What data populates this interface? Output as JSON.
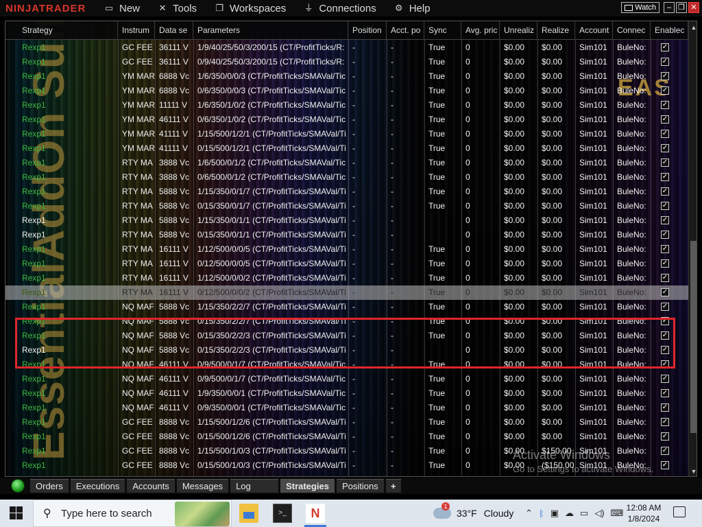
{
  "app": {
    "logo": "NINJATRADER",
    "menu": [
      {
        "label": "New",
        "icon": "new-window-icon"
      },
      {
        "label": "Tools",
        "icon": "tools-icon"
      },
      {
        "label": "Workspaces",
        "icon": "workspaces-icon"
      },
      {
        "label": "Connections",
        "icon": "plug-icon"
      },
      {
        "label": "Help",
        "icon": "help-icon"
      }
    ],
    "watch_label": "Watch"
  },
  "grid": {
    "watermark": "EssentialAddOn Suite",
    "eas_logo": "EAS",
    "columns": [
      "Strategy",
      "Instrum",
      "Data se",
      "Parameters",
      "Position",
      "Acct. po",
      "Sync",
      "Avg. pric",
      "Unrealiz",
      "Realize",
      "Account",
      "Connec",
      "Enablec"
    ],
    "rows": [
      {
        "strategy": "Rexp1",
        "instrument": "GC FEE",
        "data": "36111 V",
        "params": "1/9/40/25/50/3/200/15 (CT/ProfitTicks/R:",
        "position": "-",
        "acct": "-",
        "sync": "True",
        "avg": "0",
        "unreal": "$0.00",
        "real": "$0.00",
        "account": "Sim101",
        "conn": "BuleNo:",
        "white": false
      },
      {
        "strategy": "Rexp1",
        "instrument": "GC FEE",
        "data": "36111 V",
        "params": "0/9/40/25/50/3/200/15 (CT/ProfitTicks/R:",
        "position": "-",
        "acct": "-",
        "sync": "True",
        "avg": "0",
        "unreal": "$0.00",
        "real": "$0.00",
        "account": "Sim101",
        "conn": "BuleNo:",
        "white": false
      },
      {
        "strategy": "Rexp1",
        "instrument": "YM MAR",
        "data": "6888 Vc",
        "params": "1/6/350/0/0/3 (CT/ProfitTicks/SMAVal/Tic",
        "position": "-",
        "acct": "-",
        "sync": "True",
        "avg": "0",
        "unreal": "$0.00",
        "real": "$0.00",
        "account": "Sim101",
        "conn": "BuleNo:",
        "white": false
      },
      {
        "strategy": "Rexp1",
        "instrument": "YM MAR",
        "data": "6888 Vc",
        "params": "0/6/350/0/0/3 (CT/ProfitTicks/SMAVal/Tic",
        "position": "-",
        "acct": "-",
        "sync": "True",
        "avg": "0",
        "unreal": "$0.00",
        "real": "$0.00",
        "account": "Sim101",
        "conn": "BuleNo:",
        "white": false
      },
      {
        "strategy": "Rexp1",
        "instrument": "YM MAR",
        "data": "11111 V",
        "params": "1/6/350/1/0/2 (CT/ProfitTicks/SMAVal/Tic",
        "position": "-",
        "acct": "-",
        "sync": "True",
        "avg": "0",
        "unreal": "$0.00",
        "real": "$0.00",
        "account": "Sim101",
        "conn": "BuleNo:",
        "white": false
      },
      {
        "strategy": "Rexp1",
        "instrument": "YM MAR",
        "data": "46111 V",
        "params": "0/6/350/1/0/2 (CT/ProfitTicks/SMAVal/Tic",
        "position": "-",
        "acct": "-",
        "sync": "True",
        "avg": "0",
        "unreal": "$0.00",
        "real": "$0.00",
        "account": "Sim101",
        "conn": "BuleNo:",
        "white": false
      },
      {
        "strategy": "Rexp1",
        "instrument": "YM MAR",
        "data": "41111 V",
        "params": "1/15/500/1/2/1 (CT/ProfitTicks/SMAVal/Ti",
        "position": "-",
        "acct": "-",
        "sync": "True",
        "avg": "0",
        "unreal": "$0.00",
        "real": "$0.00",
        "account": "Sim101",
        "conn": "BuleNo:",
        "white": false
      },
      {
        "strategy": "Rexp1",
        "instrument": "YM MAR",
        "data": "41111 V",
        "params": "0/15/500/1/2/1 (CT/ProfitTicks/SMAVal/Ti",
        "position": "-",
        "acct": "-",
        "sync": "True",
        "avg": "0",
        "unreal": "$0.00",
        "real": "$0.00",
        "account": "Sim101",
        "conn": "BuleNo:",
        "white": false
      },
      {
        "strategy": "Rexp1",
        "instrument": "RTY MA",
        "data": "3888 Vc",
        "params": "1/6/500/0/1/2 (CT/ProfitTicks/SMAVal/Tic",
        "position": "-",
        "acct": "-",
        "sync": "True",
        "avg": "0",
        "unreal": "$0.00",
        "real": "$0.00",
        "account": "Sim101",
        "conn": "BuleNo:",
        "white": false
      },
      {
        "strategy": "Rexp1",
        "instrument": "RTY MA",
        "data": "3888 Vc",
        "params": "0/6/500/0/1/2 (CT/ProfitTicks/SMAVal/Tic",
        "position": "-",
        "acct": "-",
        "sync": "True",
        "avg": "0",
        "unreal": "$0.00",
        "real": "$0.00",
        "account": "Sim101",
        "conn": "BuleNo:",
        "white": false
      },
      {
        "strategy": "Rexp1",
        "instrument": "RTY MA",
        "data": "5888 Vc",
        "params": "1/15/350/0/1/7 (CT/ProfitTicks/SMAVal/Ti",
        "position": "-",
        "acct": "-",
        "sync": "True",
        "avg": "0",
        "unreal": "$0.00",
        "real": "$0.00",
        "account": "Sim101",
        "conn": "BuleNo:",
        "white": false
      },
      {
        "strategy": "Rexp1",
        "instrument": "RTY MA",
        "data": "5888 Vc",
        "params": "0/15/350/0/1/7 (CT/ProfitTicks/SMAVal/Ti",
        "position": "-",
        "acct": "-",
        "sync": "True",
        "avg": "0",
        "unreal": "$0.00",
        "real": "$0.00",
        "account": "Sim101",
        "conn": "BuleNo:",
        "white": false
      },
      {
        "strategy": "Rexp1",
        "instrument": "RTY MA",
        "data": "5888 Vc",
        "params": "1/15/350/0/1/1 (CT/ProfitTicks/SMAVal/Ti",
        "position": "-",
        "acct": "-",
        "sync": "",
        "avg": "0",
        "unreal": "$0.00",
        "real": "$0.00",
        "account": "Sim101",
        "conn": "BuleNo:",
        "white": true
      },
      {
        "strategy": "Rexp1",
        "instrument": "RTY MA",
        "data": "5888 Vc",
        "params": "0/15/350/0/1/1 (CT/ProfitTicks/SMAVal/Ti",
        "position": "-",
        "acct": "-",
        "sync": "",
        "avg": "0",
        "unreal": "$0.00",
        "real": "$0.00",
        "account": "Sim101",
        "conn": "BuleNo:",
        "white": true
      },
      {
        "strategy": "Rexp1",
        "instrument": "RTY MA",
        "data": "16111 V",
        "params": "1/12/500/0/0/5 (CT/ProfitTicks/SMAVal/Ti",
        "position": "-",
        "acct": "-",
        "sync": "True",
        "avg": "0",
        "unreal": "$0.00",
        "real": "$0.00",
        "account": "Sim101",
        "conn": "BuleNo:",
        "white": false
      },
      {
        "strategy": "Rexp1",
        "instrument": "RTY MA",
        "data": "16111 V",
        "params": "0/12/500/0/0/5 (CT/ProfitTicks/SMAVal/Ti",
        "position": "-",
        "acct": "-",
        "sync": "True",
        "avg": "0",
        "unreal": "$0.00",
        "real": "$0.00",
        "account": "Sim101",
        "conn": "BuleNo:",
        "white": false
      },
      {
        "strategy": "Rexp1",
        "instrument": "RTY MA",
        "data": "16111 V",
        "params": "1/12/500/0/0/2 (CT/ProfitTicks/SMAVal/Ti",
        "position": "-",
        "acct": "-",
        "sync": "True",
        "avg": "0",
        "unreal": "$0.00",
        "real": "$0.00",
        "account": "Sim101",
        "conn": "BuleNo:",
        "white": false
      },
      {
        "strategy": "Rexp1",
        "instrument": "RTY MA",
        "data": "16111 V",
        "params": "0/12/500/0/0/2 (CT/ProfitTicks/SMAVal/Ti",
        "position": "-",
        "acct": "-",
        "sync": "True",
        "avg": "0",
        "unreal": "$0.00",
        "real": "$0.00",
        "account": "Sim101",
        "conn": "BuleNo:",
        "white": false,
        "selected": true
      },
      {
        "strategy": "Rexp1",
        "instrument": "NQ MAF",
        "data": "5888 Vc",
        "params": "1/15/350/2/2/7 (CT/ProfitTicks/SMAVal/Ti",
        "position": "-",
        "acct": "-",
        "sync": "True",
        "avg": "0",
        "unreal": "$0.00",
        "real": "$0.00",
        "account": "Sim101",
        "conn": "BuleNo:",
        "white": false
      },
      {
        "strategy": "Rexp1",
        "instrument": "NQ MAF",
        "data": "5888 Vc",
        "params": "0/15/350/2/2/7 (CT/ProfitTicks/SMAVal/Ti",
        "position": "-",
        "acct": "-",
        "sync": "True",
        "avg": "0",
        "unreal": "$0.00",
        "real": "$0.00",
        "account": "Sim101",
        "conn": "BuleNo:",
        "white": false
      },
      {
        "strategy": "Rexp1",
        "instrument": "NQ MAF",
        "data": "5888 Vc",
        "params": "0/15/350/2/2/3 (CT/ProfitTicks/SMAVal/Ti",
        "position": "-",
        "acct": "-",
        "sync": "True",
        "avg": "0",
        "unreal": "$0.00",
        "real": "$0.00",
        "account": "Sim101",
        "conn": "BuleNo:",
        "white": false
      },
      {
        "strategy": "Rexp1",
        "instrument": "NQ MAF",
        "data": "5888 Vc",
        "params": "0/15/350/2/2/3 (CT/ProfitTicks/SMAVal/Ti",
        "position": "-",
        "acct": "-",
        "sync": "",
        "avg": "0",
        "unreal": "$0.00",
        "real": "$0.00",
        "account": "Sim101",
        "conn": "BuleNo:",
        "white": true
      },
      {
        "strategy": "Rexp1",
        "instrument": "NQ MAF",
        "data": "46111 V",
        "params": "0/9/500/0/1/7 (CT/ProfitTicks/SMAVal/Tic",
        "position": "-",
        "acct": "-",
        "sync": "True",
        "avg": "0",
        "unreal": "$0.00",
        "real": "$0.00",
        "account": "Sim101",
        "conn": "BuleNo:",
        "white": false
      },
      {
        "strategy": "Rexp1",
        "instrument": "NQ MAF",
        "data": "46111 V",
        "params": "0/9/500/0/1/7 (CT/ProfitTicks/SMAVal/Tic",
        "position": "-",
        "acct": "-",
        "sync": "True",
        "avg": "0",
        "unreal": "$0.00",
        "real": "$0.00",
        "account": "Sim101",
        "conn": "BuleNo:",
        "white": false
      },
      {
        "strategy": "Rexp1",
        "instrument": "NQ MAF",
        "data": "46111 V",
        "params": "1/9/350/0/0/1 (CT/ProfitTicks/SMAVal/Tic",
        "position": "-",
        "acct": "-",
        "sync": "True",
        "avg": "0",
        "unreal": "$0.00",
        "real": "$0.00",
        "account": "Sim101",
        "conn": "BuleNo:",
        "white": false
      },
      {
        "strategy": "Rexp1",
        "instrument": "NQ MAF",
        "data": "46111 V",
        "params": "0/9/350/0/0/1 (CT/ProfitTicks/SMAVal/Tic",
        "position": "-",
        "acct": "-",
        "sync": "True",
        "avg": "0",
        "unreal": "$0.00",
        "real": "$0.00",
        "account": "Sim101",
        "conn": "BuleNo:",
        "white": false
      },
      {
        "strategy": "Rexp1",
        "instrument": "GC FEE",
        "data": "8888 Vc",
        "params": "1/15/500/1/2/6 (CT/ProfitTicks/SMAVal/Ti",
        "position": "-",
        "acct": "-",
        "sync": "True",
        "avg": "0",
        "unreal": "$0.00",
        "real": "$0.00",
        "account": "Sim101",
        "conn": "BuleNo:",
        "white": false
      },
      {
        "strategy": "Rexp1",
        "instrument": "GC FEE",
        "data": "8888 Vc",
        "params": "0/15/500/1/2/6 (CT/ProfitTicks/SMAVal/Ti",
        "position": "-",
        "acct": "-",
        "sync": "True",
        "avg": "0",
        "unreal": "$0.00",
        "real": "$0.00",
        "account": "Sim101",
        "conn": "BuleNo:",
        "white": false
      },
      {
        "strategy": "Rexp1",
        "instrument": "GC FEE",
        "data": "8888 Vc",
        "params": "1/15/500/1/0/3 (CT/ProfitTicks/SMAVal/Ti",
        "position": "-",
        "acct": "-",
        "sync": "True",
        "avg": "0",
        "unreal": "$0.00",
        "real": "$150.00",
        "account": "Sim101",
        "conn": "BuleNo:",
        "white": false
      },
      {
        "strategy": "Rexp1",
        "instrument": "GC FEE",
        "data": "8888 Vc",
        "params": "0/15/500/1/0/3 (CT/ProfitTicks/SMAVal/Ti",
        "position": "-",
        "acct": "-",
        "sync": "True",
        "avg": "0",
        "unreal": "$0.00",
        "real": "($150.00",
        "account": "Sim101",
        "conn": "BuleNo:",
        "white": false
      }
    ]
  },
  "tabs": [
    {
      "label": "Orders"
    },
    {
      "label": "Executions"
    },
    {
      "label": "Accounts"
    },
    {
      "label": "Messages"
    },
    {
      "label": "Log"
    },
    {
      "label": "Strategies",
      "active": true
    },
    {
      "label": "Positions"
    },
    {
      "label": "+"
    }
  ],
  "activation": {
    "title": "Activate Windows",
    "subtitle": "Go to Settings to activate Windows."
  },
  "taskbar": {
    "search_placeholder": "Type here to search",
    "weather_temp": "33°F",
    "weather_desc": "Cloudy",
    "weather_badge": "1",
    "time": "12:08 AM",
    "date": "1/8/2024",
    "tray_icons": [
      "chevron-up-icon",
      "bluetooth-icon",
      "meet-icon",
      "onedrive-icon",
      "network-icon",
      "volume-icon",
      "ime-icon"
    ],
    "apps": [
      "file-explorer-icon",
      "terminal-icon",
      "ninjatrader-icon"
    ]
  }
}
